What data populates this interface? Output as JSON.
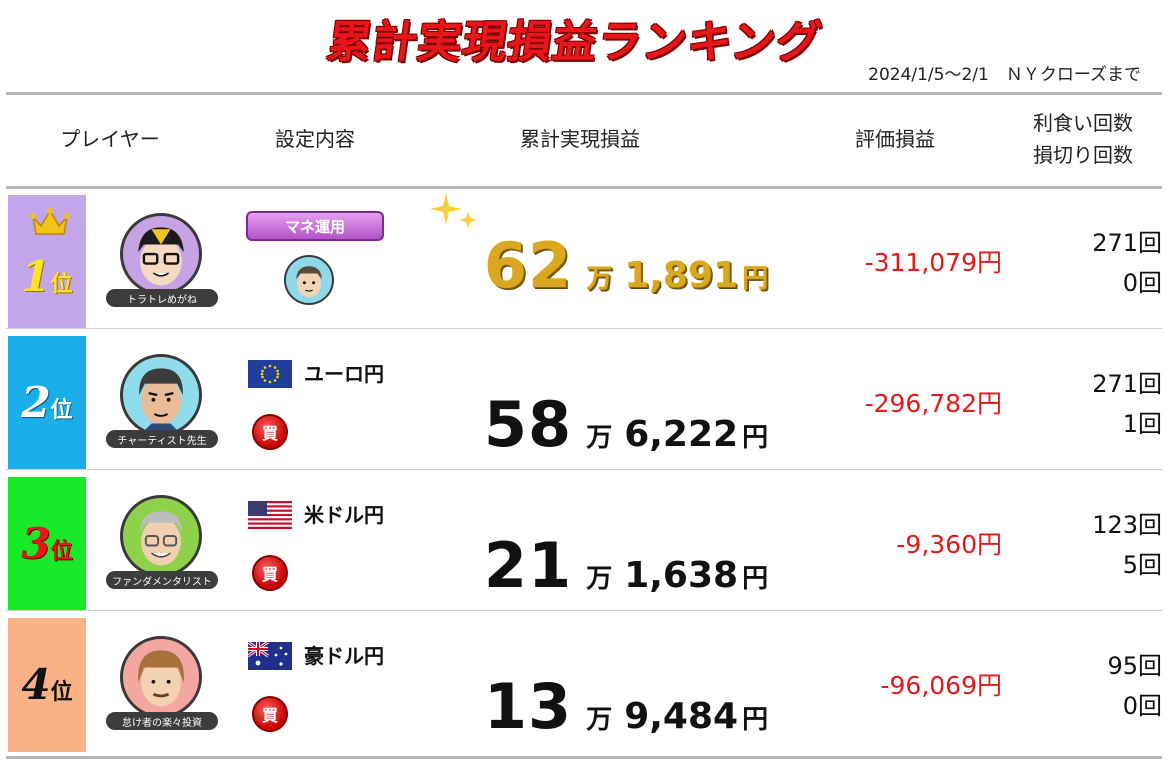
{
  "title": "累計実現損益ランキング",
  "period": "2024/1/5～2/1　ＮＹクローズまで",
  "headers": {
    "player": "プレイヤー",
    "setting": "設定内容",
    "total": "累計実現損益",
    "eval": "評価損益",
    "wins": "利食い回数",
    "losses": "損切り回数"
  },
  "rows": [
    {
      "rank_num": "1",
      "rank_suffix": "位",
      "rank_color": "#c3a5e9",
      "player": "トラトレめがね",
      "setting": "マネ運用",
      "man": "62",
      "man_unit": "万",
      "rest": "1,891",
      "yen": "円",
      "eval": "-311,079円",
      "wins": "271回",
      "losses": "0回"
    },
    {
      "rank_num": "2",
      "rank_suffix": "位",
      "rank_color": "#19aeea",
      "player": "チャーティスト先生",
      "pair": "ユーロ円",
      "flag": "eu-flag-icon",
      "order": "買",
      "man": "58",
      "man_unit": "万",
      "rest": "6,222",
      "yen": "円",
      "eval": "-296,782円",
      "wins": "271回",
      "losses": "1回"
    },
    {
      "rank_num": "3",
      "rank_suffix": "位",
      "rank_color": "#18ea2a",
      "player": "ファンダメンタリスト",
      "pair": "米ドル円",
      "flag": "us-flag-icon",
      "order": "買",
      "man": "21",
      "man_unit": "万",
      "rest": "1,638",
      "yen": "円",
      "eval": "-9,360円",
      "wins": "123回",
      "losses": "5回"
    },
    {
      "rank_num": "4",
      "rank_suffix": "位",
      "rank_color": "#f9b185",
      "player": "怠け者の楽々投資",
      "pair": "豪ドル円",
      "flag": "au-flag-icon",
      "order": "買",
      "man": "13",
      "man_unit": "万",
      "rest": "9,484",
      "yen": "円",
      "eval": "-96,069円",
      "wins": "95回",
      "losses": "0回"
    }
  ],
  "colors": {
    "title": "#e8151b",
    "negative": "#e11b1b",
    "gold": "#d9a81e"
  }
}
